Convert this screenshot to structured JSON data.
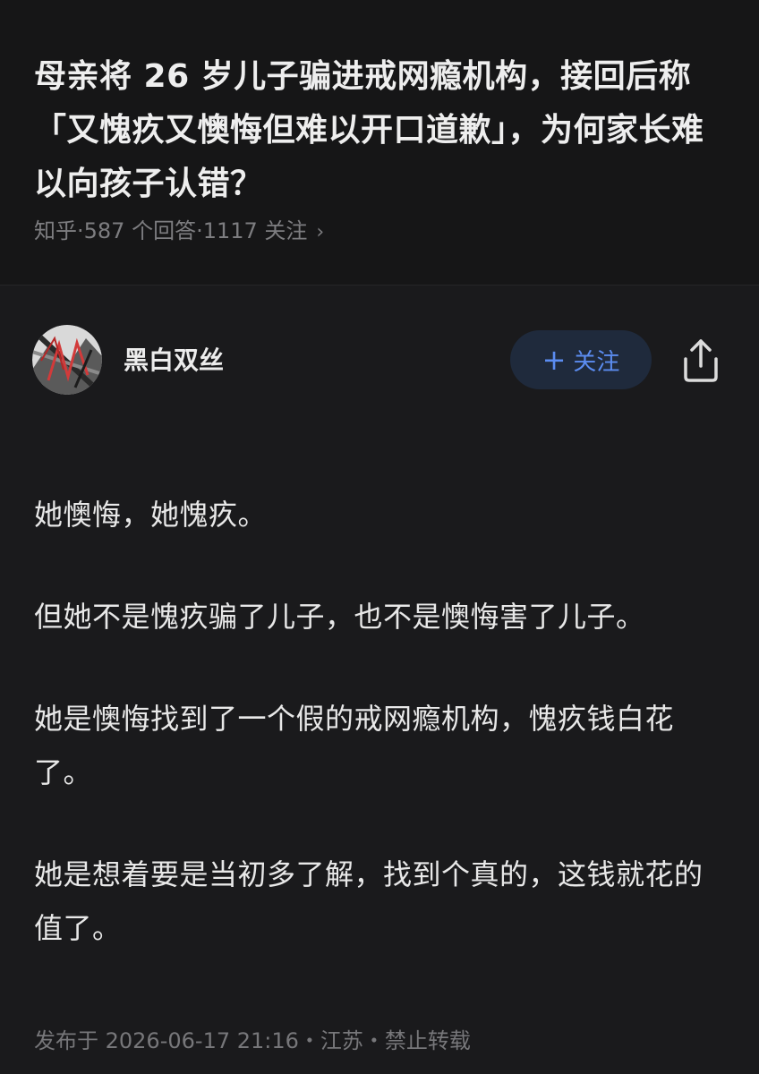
{
  "question": {
    "title": "母亲将 26 岁儿子骗进戒网瘾机构，接回后称「又愧疚又懊悔但难以开口道歉」，为何家长难以向孩子认错？",
    "meta": "知乎·587 个回答·1117 关注",
    "meta_chevron": "›"
  },
  "author": {
    "name": "黑白双丝",
    "avatar_icon": "avatar-image",
    "follow_icon": "+",
    "follow_label": "关注",
    "share_icon": "share-icon"
  },
  "answer": {
    "paragraphs": [
      "她懊悔，她愧疚。",
      "但她不是愧疚骗了儿子，也不是懊悔害了儿子。",
      "她是懊悔找到了一个假的戒网瘾机构，愧疚钱白花了。",
      "她是想着要是当初多了解，找到个真的，这钱就花的值了。"
    ],
    "footer": "发布于 2026-06-17 21:16・江苏・禁止转载"
  },
  "colors": {
    "background": "#121212",
    "accent": "#5b8cf0",
    "follow_bg": "#1f2a3c",
    "muted_text": "#7d7d80"
  }
}
